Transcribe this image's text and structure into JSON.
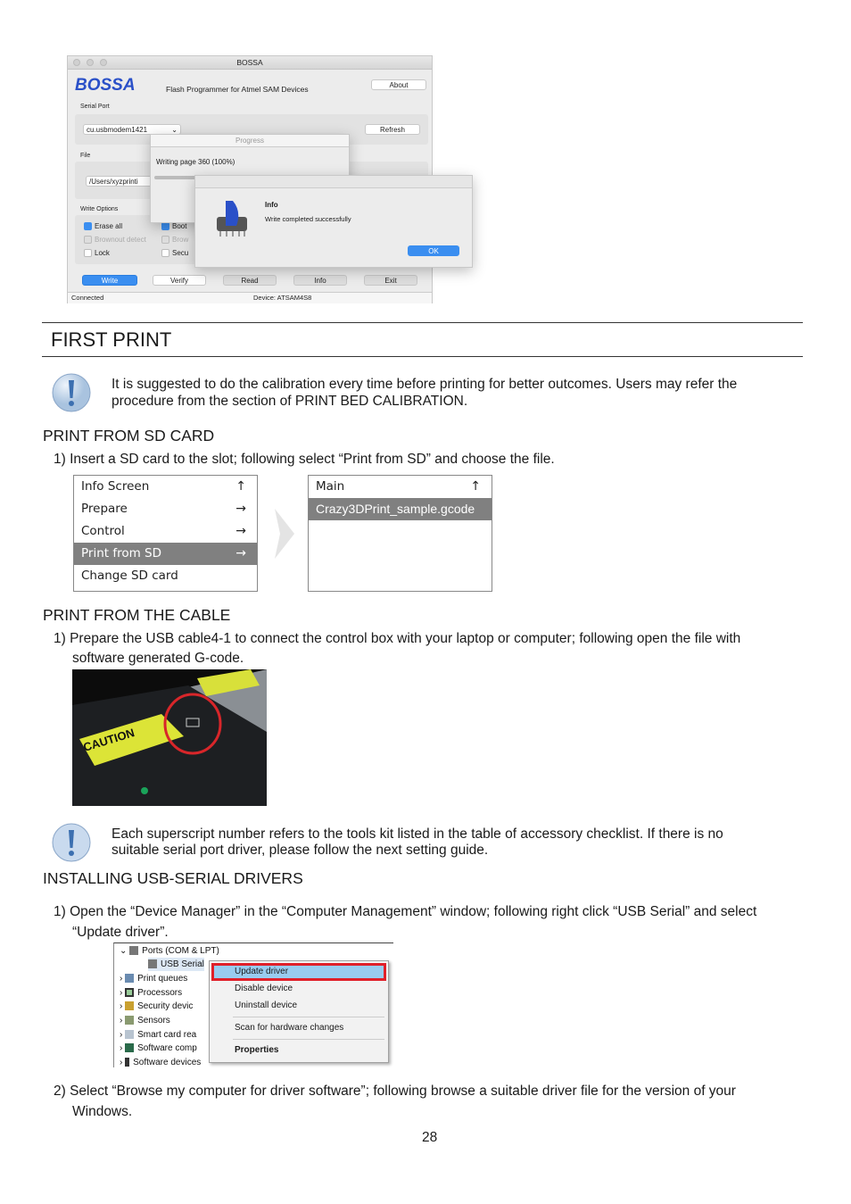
{
  "bossa": {
    "window_title": "BOSSA",
    "logo": "BOSSA",
    "subtitle": "Flash Programmer for Atmel SAM Devices",
    "about": "About",
    "serial_port_label": "Serial Port",
    "serial_port_value": "cu.usbmodem1421",
    "refresh": "Refresh",
    "file_label": "File",
    "file_value": "/Users/xyzprinti",
    "write_options_label": "Write Options",
    "erase_all": "Erase all",
    "boot": "Boot",
    "brownout_detect": "Brownout detect",
    "brownout_reset": "Brow",
    "lock": "Lock",
    "security": "Secu",
    "buttons": [
      "Write",
      "Verify",
      "Read",
      "Info",
      "Exit"
    ],
    "status_left": "Connected",
    "status_device": "Device: ATSAM4S8",
    "progress": {
      "title": "Progress",
      "text": "Writing page 360 (100%)",
      "value_percent": 100
    },
    "info": {
      "title": "Info",
      "message": "Write completed successfully",
      "ok": "OK"
    },
    "accent": "#3a8ef0"
  },
  "section_title": "FIRST PRINT",
  "note1": {
    "icon": "exclamation-icon",
    "lines": [
      "It is suggested to do the calibration every time before printing for better outcomes. Users may refer the",
      "procedure from the section of PRINT BED CALIBRATION."
    ]
  },
  "sd": {
    "heading": "PRINT FROM SD CARD",
    "step1": "1)  Insert a SD card to the slot; following select “Print from SD” and choose the file.",
    "menu1": [
      {
        "label": "Info Screen",
        "icon": "↑"
      },
      {
        "label": "Prepare",
        "icon": "→"
      },
      {
        "label": "Control",
        "icon": "→"
      },
      {
        "label": "Print from SD",
        "icon": "→",
        "selected": true
      },
      {
        "label": "Change SD card",
        "icon": ""
      }
    ],
    "menu2": [
      {
        "label": "Main",
        "icon": "↑"
      },
      {
        "label": "Crazy3DPrint_sample.gcode",
        "icon": "",
        "selected": true
      }
    ]
  },
  "cable": {
    "heading": "PRINT FROM THE CABLE",
    "step1_lines": [
      "1)  Prepare the USB cable4-1 to connect the control box with your laptop or computer; following open the file with",
      "software generated G-code."
    ],
    "photo_label": "CAUTION"
  },
  "note2": {
    "icon": "exclamation-icon",
    "lines": [
      "Each superscript number refers to the tools kit listed in the table of accessory checklist. If there is no",
      "suitable serial port driver, please follow the next setting guide."
    ]
  },
  "usb": {
    "heading": "INSTALLING USB-SERIAL DRIVERS",
    "step1_lines": [
      "1)  Open the “Device Manager” in the “Computer Management” window; following right click “USB Serial” and select",
      "“Update driver”."
    ],
    "tree": [
      "Ports (COM & LPT)",
      "USB Serial",
      "Print queues",
      "Processors",
      "Security devic",
      "Sensors",
      "Smart card rea",
      "Software comp",
      "Software devices"
    ],
    "context_menu": [
      "Update driver",
      "Disable device",
      "Uninstall device",
      "Scan for hardware changes",
      "Properties"
    ],
    "step2_lines": [
      "2)  Select “Browse my computer for driver software”; following browse a suitable driver file for the version of your",
      "Windows."
    ]
  },
  "page_number": "28"
}
